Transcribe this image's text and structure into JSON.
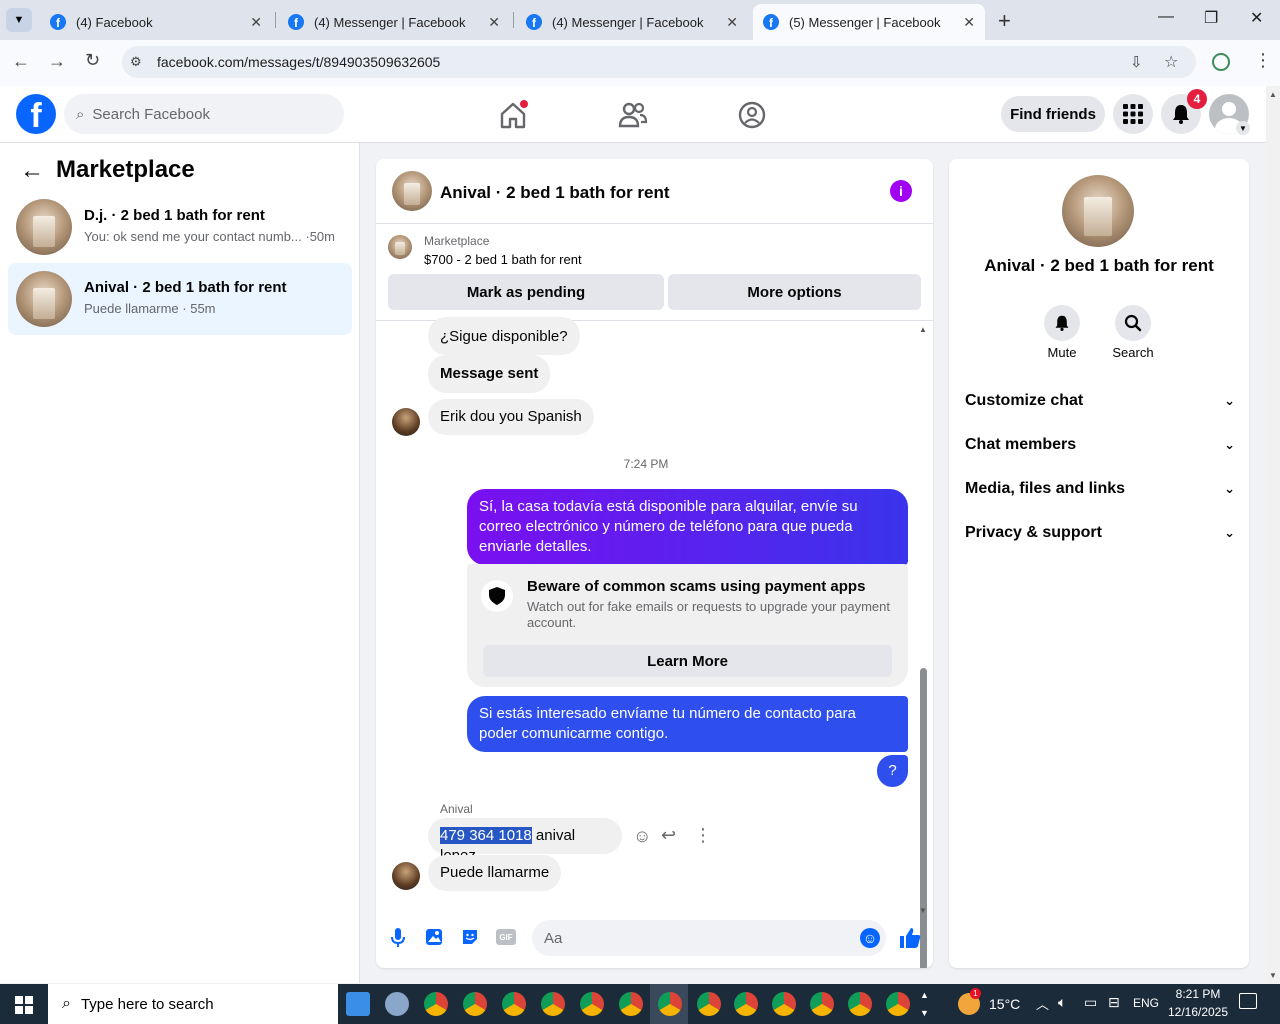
{
  "browser": {
    "tabs": [
      {
        "title": "(4) Facebook",
        "active": false
      },
      {
        "title": "(4) Messenger | Facebook",
        "active": false
      },
      {
        "title": "(4) Messenger | Facebook",
        "active": false
      },
      {
        "title": "(5) Messenger | Facebook",
        "active": true
      }
    ],
    "url": "facebook.com/messages/t/894903509632605"
  },
  "header": {
    "logo": "f",
    "search_placeholder": "Search Facebook",
    "find_friends": "Find friends",
    "notif_count": "4"
  },
  "left": {
    "title": "Marketplace",
    "convos": [
      {
        "name": "D.j. · 2 bed 1 bath for rent",
        "preview": "You: ok send me your contact numb... ·50m"
      },
      {
        "name": "Anival · 2 bed 1 bath for rent",
        "preview": "Puede llamarme · 55m"
      }
    ]
  },
  "chat": {
    "title": "Anival · 2 bed 1 bath for rent",
    "listing_label": "Marketplace",
    "listing_price": "$700 - 2 bed 1 bath for rent",
    "mark_pending": "Mark as pending",
    "more_options": "More options",
    "messages": {
      "m1": "¿Sigue disponible?",
      "m2": "Message sent",
      "m3": "Erik dou you Spanish",
      "time": "7:24 PM",
      "m4": "Sí, la casa todavía está disponible para alquilar, envíe su correo electrónico y número de teléfono para que pueda enviarle detalles.",
      "scam_title": "Beware of common scams using payment apps",
      "scam_body": "Watch out for fake emails or requests to upgrade your payment account.",
      "learn_more": "Learn More",
      "m5": "Si estás interesado envíame tu número de contacto para poder comunicarme contigo.",
      "m6": "?",
      "sender": "Anival",
      "m7_phone": "479 364 1018",
      "m7_rest": " anival lopez",
      "m8": "Puede llamarme"
    },
    "composer_placeholder": "Aa",
    "gif_label": "GIF"
  },
  "right": {
    "title": "Anival · 2 bed 1 bath for rent",
    "mute": "Mute",
    "search": "Search",
    "sections": [
      "Customize chat",
      "Chat members",
      "Media, files and links",
      "Privacy & support"
    ]
  },
  "taskbar": {
    "search_placeholder": "Type here to search",
    "weather": "15°C",
    "lang": "ENG",
    "time": "8:21 PM",
    "date": "12/16/2025",
    "weather_badge": "1"
  }
}
